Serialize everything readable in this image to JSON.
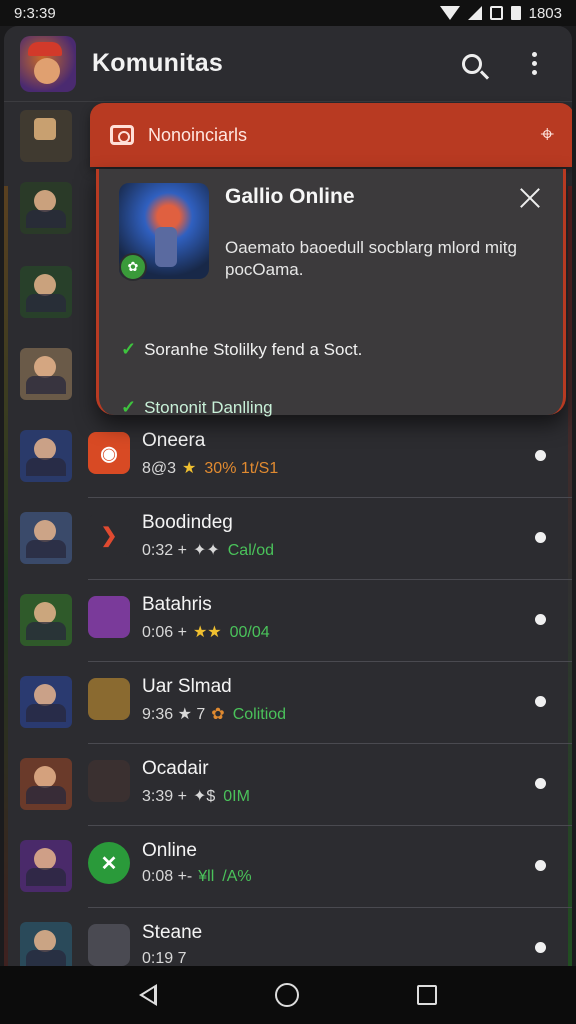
{
  "status": {
    "time": "9:3:39",
    "battery_text": "1803"
  },
  "appbar": {
    "title": "Komunitas",
    "search_icon": "search-icon",
    "menu_icon": "more-vert-icon"
  },
  "panel": {
    "header_label": "Nonoinciarls",
    "header_icon": "camera-icon",
    "tool_icon": "crosshair-icon",
    "accent": "#b83a22"
  },
  "card": {
    "title": "Gallio Online",
    "description": "Oaemato baoedull socblarg mlord mitg pocOama.",
    "checks": [
      {
        "text": "Soranhe Stolilky fend a Soct."
      },
      {
        "text": "Stononit Danlling"
      }
    ],
    "check_color": "#3ec33e"
  },
  "rows": [
    {
      "name": "Oneera",
      "meta1": "8@3",
      "meta2": "★",
      "meta3": "30% 1t/S1",
      "meta3_color": "#e08a30",
      "icon_bg": "#d84a24",
      "icon_text": "◉"
    },
    {
      "name": "Boodindeg",
      "meta1": "0:32 +",
      "meta2": "✦✦",
      "meta3": "Cal/od",
      "meta3_color": "#4ac25a",
      "icon_bg": "#2c2c30",
      "icon_text": "❯"
    },
    {
      "name": "Batahris",
      "meta1": "0:06 +",
      "meta2": "★★",
      "meta3": "00/04",
      "meta3_color": "#4ac25a",
      "icon_bg": "#7a3a9a",
      "icon_text": ""
    },
    {
      "name": "Uar Slmad",
      "meta1": "9:36 ★ 7",
      "meta2": "✿",
      "meta3": "Colitiod",
      "meta3_color": "#4ac25a",
      "icon_bg": "#8a6a30",
      "icon_text": ""
    },
    {
      "name": "Ocadair",
      "meta1": "3:39 +",
      "meta2": "✦$",
      "meta3": "0IM",
      "meta3_color": "#4ac25a",
      "icon_bg": "#3a3030",
      "icon_text": ""
    },
    {
      "name": "Online",
      "meta1": "0:08 +-",
      "meta2": "¥ll",
      "meta3": "/A%",
      "meta3_color": "#4ac25a",
      "icon_bg": "#2a9a3a",
      "icon_text": "✕"
    },
    {
      "name": "Steane",
      "meta1": "0:19 7",
      "meta2": "",
      "meta3": "",
      "meta3_color": "#4ac25a",
      "icon_bg": "#4a4a52",
      "icon_text": ""
    }
  ],
  "nav": {
    "back_icon": "back-icon",
    "home_icon": "home-icon",
    "recent_icon": "recents-icon"
  }
}
